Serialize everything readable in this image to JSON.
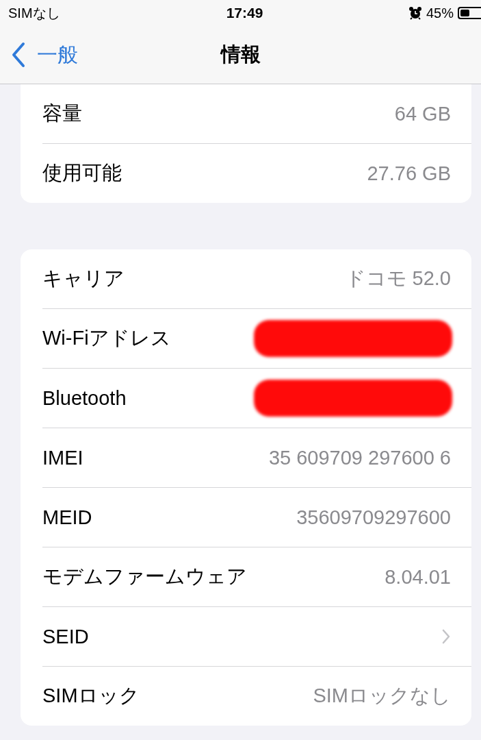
{
  "status_bar": {
    "carrier": "SIMなし",
    "time": "17:49",
    "battery": "45%"
  },
  "nav": {
    "back": "一般",
    "title": "情報"
  },
  "groups": [
    {
      "rows": [
        {
          "label": "容量",
          "value": "64 GB",
          "kind": "value"
        },
        {
          "label": "使用可能",
          "value": "27.76 GB",
          "kind": "value"
        }
      ]
    },
    {
      "rows": [
        {
          "label": "キャリア",
          "value": "ドコモ 52.0",
          "kind": "value"
        },
        {
          "label": "Wi-Fiアドレス",
          "kind": "value",
          "redacted": true
        },
        {
          "label": "Bluetooth",
          "kind": "value",
          "redacted": true
        },
        {
          "label": "IMEI",
          "value": "35 609709 297600 6",
          "kind": "value"
        },
        {
          "label": "MEID",
          "value": "35609709297600",
          "kind": "value"
        },
        {
          "label": "モデムファームウェア",
          "value": "8.04.01",
          "kind": "value"
        },
        {
          "label": "SEID",
          "kind": "disclosure"
        },
        {
          "label": "SIMロック",
          "value": "SIMロックなし",
          "kind": "value"
        }
      ]
    }
  ]
}
